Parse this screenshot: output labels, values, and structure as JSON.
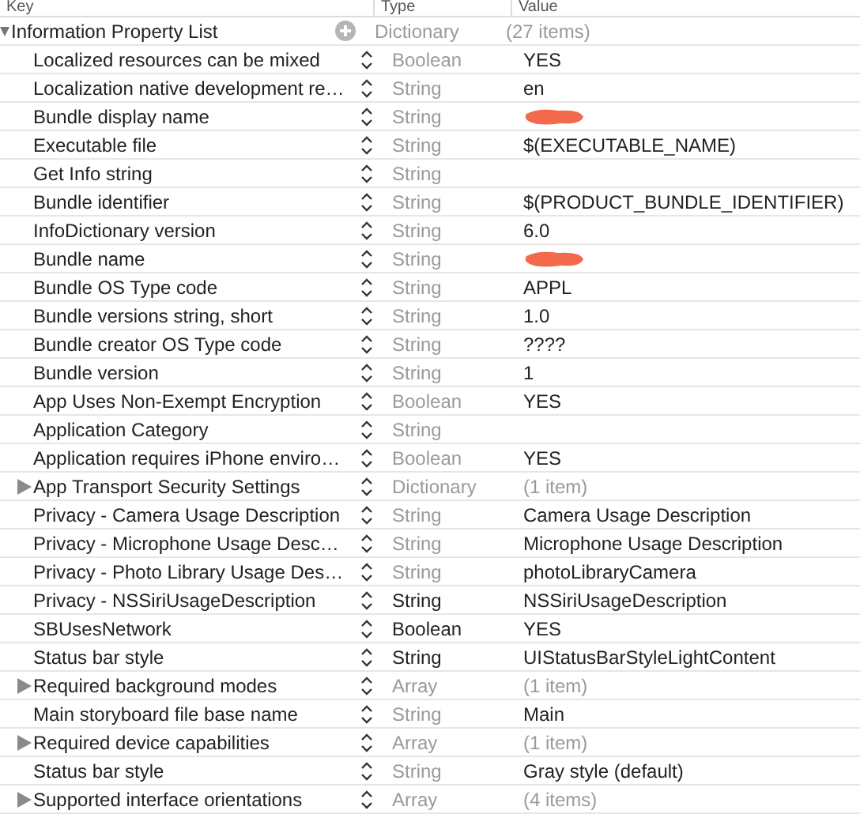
{
  "columns": [
    "Key",
    "Type",
    "Value"
  ],
  "root": {
    "key": "Information Property List",
    "type": "Dictionary",
    "value": "(27 items)",
    "expanded": true,
    "children": [
      {
        "key": "Localized resources can be mixed",
        "type": "Boolean",
        "value": "YES",
        "kind": "value",
        "type_dimmed": true
      },
      {
        "key": "Localization native development re…",
        "type": "String",
        "value": "en",
        "kind": "value",
        "type_dimmed": true
      },
      {
        "key": "Bundle display name",
        "type": "String",
        "kind": "redacted",
        "type_dimmed": true
      },
      {
        "key": "Executable file",
        "type": "String",
        "value": "$(EXECUTABLE_NAME)",
        "kind": "value",
        "type_dimmed": true
      },
      {
        "key": "Get Info string",
        "type": "String",
        "kind": "value",
        "type_dimmed": true
      },
      {
        "key": "Bundle identifier",
        "type": "String",
        "value": "$(PRODUCT_BUNDLE_IDENTIFIER)",
        "kind": "value",
        "type_dimmed": true
      },
      {
        "key": "InfoDictionary version",
        "type": "String",
        "value": "6.0",
        "kind": "value",
        "type_dimmed": true
      },
      {
        "key": "Bundle name",
        "type": "String",
        "kind": "redacted",
        "type_dimmed": true
      },
      {
        "key": "Bundle OS Type code",
        "type": "String",
        "value": "APPL",
        "kind": "value",
        "type_dimmed": true
      },
      {
        "key": "Bundle versions string, short",
        "type": "String",
        "value": "1.0",
        "kind": "value",
        "type_dimmed": true
      },
      {
        "key": "Bundle creator OS Type code",
        "type": "String",
        "value": "????",
        "kind": "value",
        "type_dimmed": true
      },
      {
        "key": "Bundle version",
        "type": "String",
        "value": "1",
        "kind": "value",
        "type_dimmed": true
      },
      {
        "key": "App Uses Non-Exempt Encryption",
        "type": "Boolean",
        "value": "YES",
        "kind": "value",
        "type_dimmed": true
      },
      {
        "key": "Application Category",
        "type": "String",
        "kind": "value",
        "type_dimmed": true
      },
      {
        "key": "Application requires iPhone enviro…",
        "type": "Boolean",
        "value": "YES",
        "kind": "value",
        "type_dimmed": true
      },
      {
        "key": "App Transport Security Settings",
        "type": "Dictionary",
        "value": "(1 item)",
        "kind": "container",
        "expanded": false,
        "type_dimmed": true
      },
      {
        "key": "Privacy - Camera Usage Description",
        "type": "String",
        "value": "Camera Usage Description",
        "kind": "value",
        "type_dimmed": true
      },
      {
        "key": "Privacy - Microphone Usage Desc…",
        "type": "String",
        "value": "Microphone Usage Description",
        "kind": "value",
        "type_dimmed": true
      },
      {
        "key": "Privacy - Photo Library Usage Des…",
        "type": "String",
        "value": "photoLibraryCamera",
        "kind": "value",
        "type_dimmed": true
      },
      {
        "key": "Privacy - NSSiriUsageDescription",
        "type": "String",
        "value": "NSSiriUsageDescription",
        "kind": "value",
        "type_dimmed": false
      },
      {
        "key": "SBUsesNetwork",
        "type": "Boolean",
        "value": "YES",
        "kind": "value",
        "type_dimmed": false
      },
      {
        "key": "Status bar style",
        "type": "String",
        "value": "UIStatusBarStyleLightContent",
        "kind": "value",
        "type_dimmed": false
      },
      {
        "key": "Required background modes",
        "type": "Array",
        "value": "(1 item)",
        "kind": "container",
        "expanded": false,
        "type_dimmed": true
      },
      {
        "key": "Main storyboard file base name",
        "type": "String",
        "value": "Main",
        "kind": "value",
        "type_dimmed": true
      },
      {
        "key": "Required device capabilities",
        "type": "Array",
        "value": "(1 item)",
        "kind": "container",
        "expanded": false,
        "type_dimmed": true
      },
      {
        "key": "Status bar style",
        "type": "String",
        "value": "Gray style (default)",
        "kind": "value",
        "type_dimmed": true
      },
      {
        "key": "Supported interface orientations",
        "type": "Array",
        "value": "(4 items)",
        "kind": "container",
        "expanded": false,
        "type_dimmed": true
      }
    ]
  }
}
